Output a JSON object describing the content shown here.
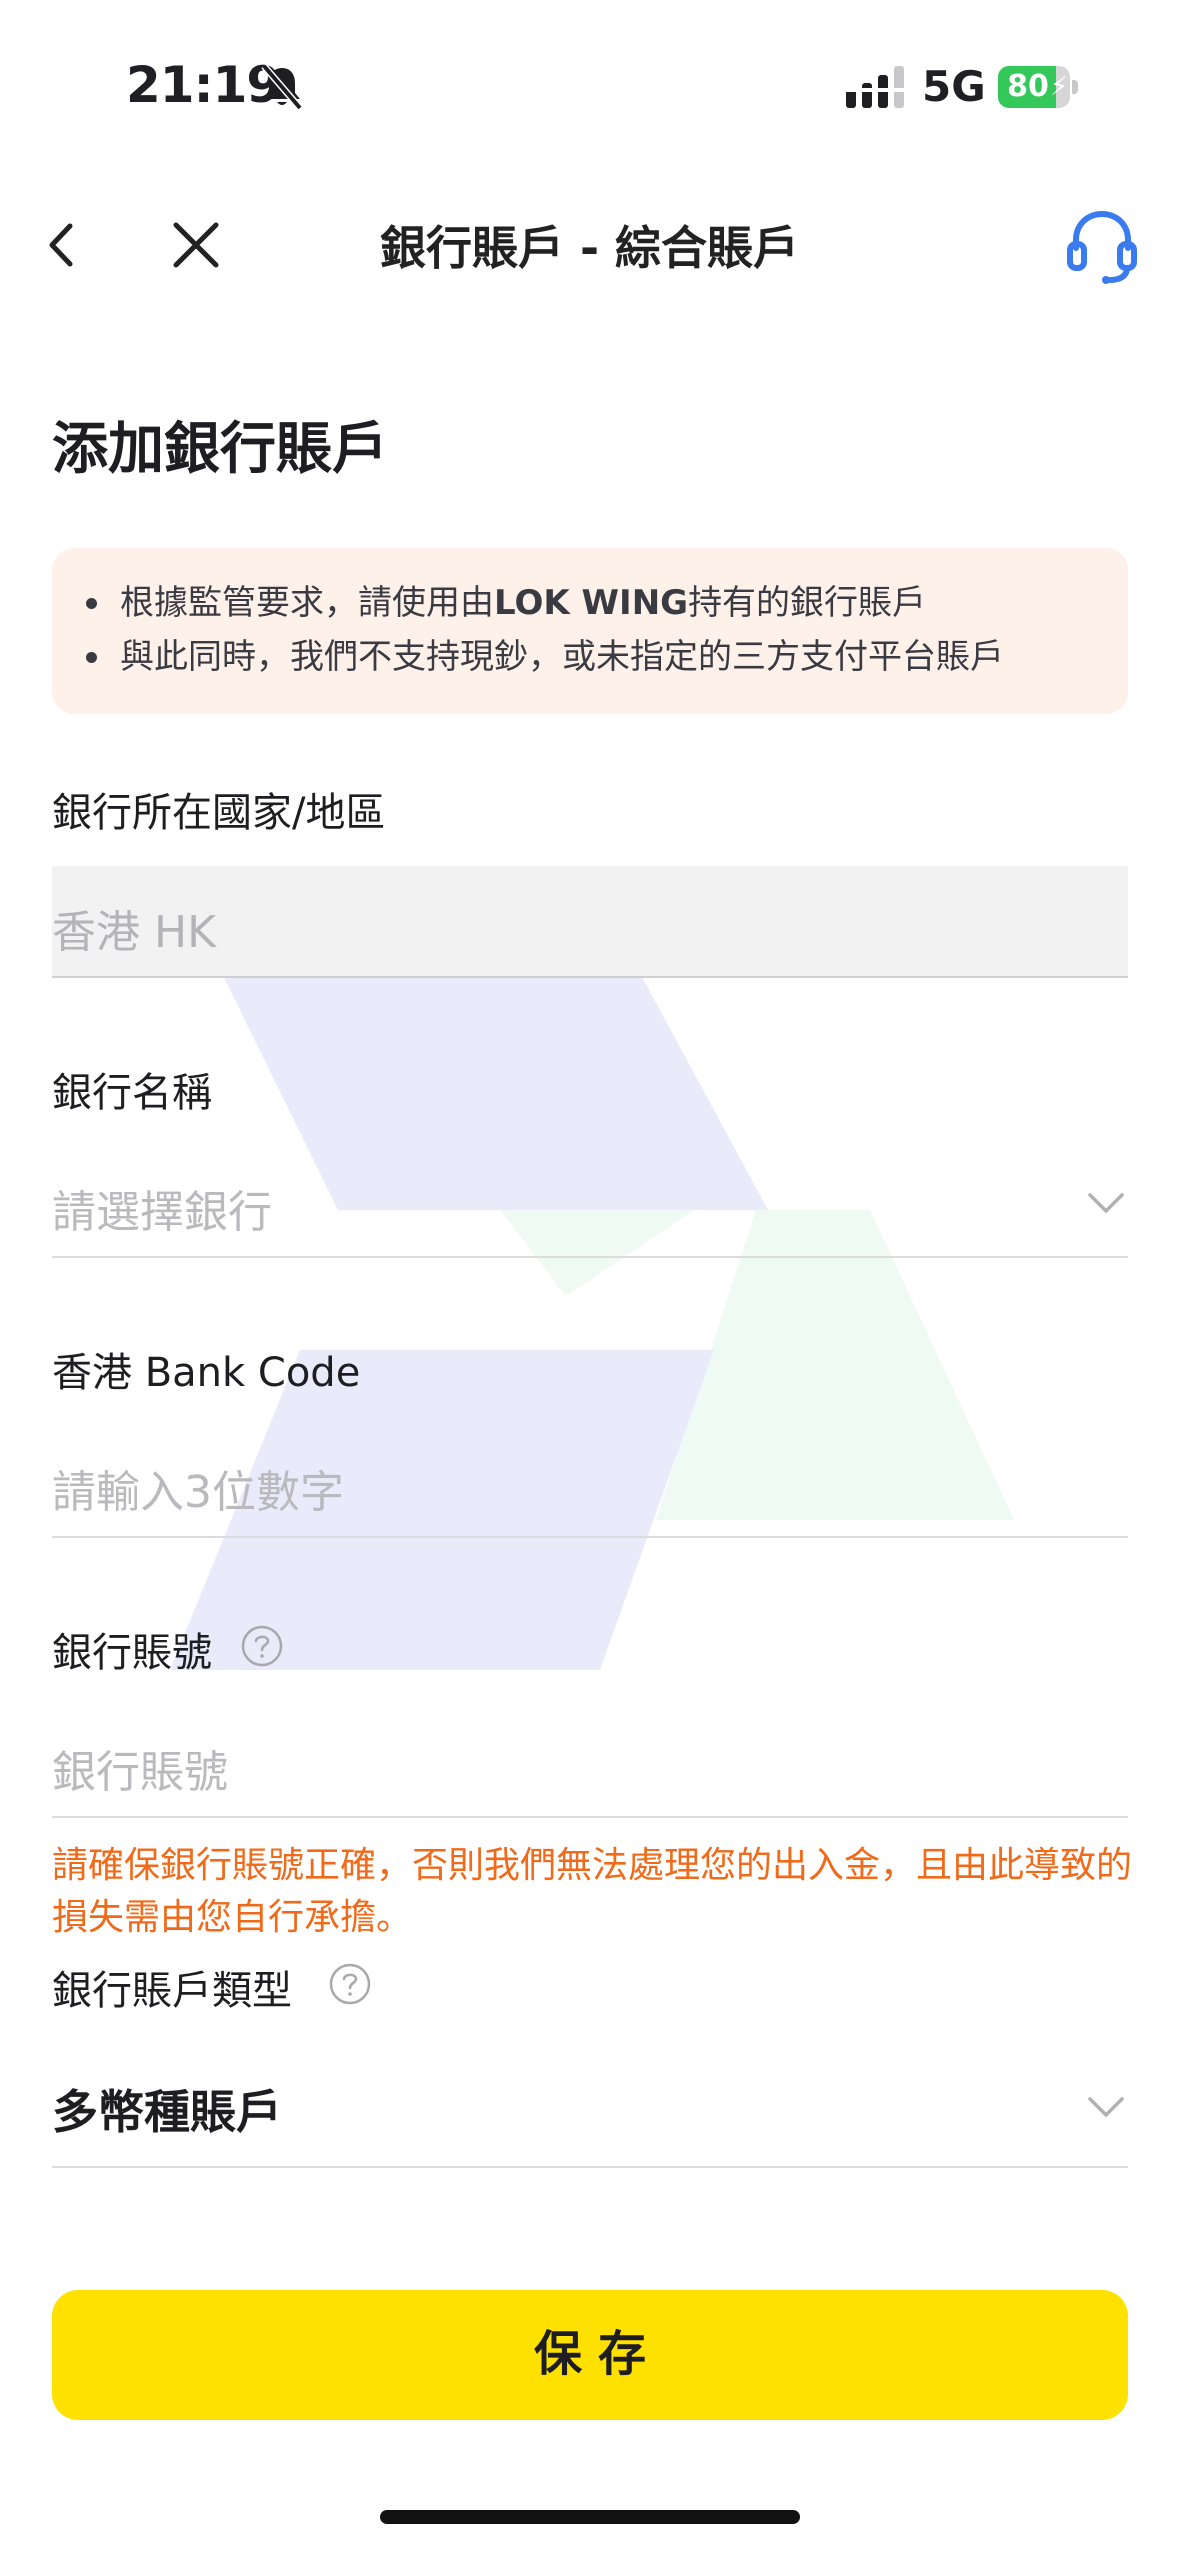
{
  "status_bar": {
    "time": "21:19",
    "network": "5G",
    "battery_percent_text": "80",
    "battery_level": 0.8,
    "battery_color": "#34c759"
  },
  "nav": {
    "title": "銀行賬戶 - 綜合賬戶",
    "back_icon": "chevron-left-icon",
    "close_icon": "close-icon",
    "support_icon": "headset-icon",
    "accent_color": "#3a7bf0"
  },
  "page_title": "添加銀行賬戶",
  "notice": {
    "background": "#fdf1e9",
    "items": [
      {
        "prefix": "根據監管要求，請使用由",
        "highlight": "LOK WING",
        "suffix": "持有的銀行賬戶"
      },
      {
        "prefix": "與此同時，我們不支持現鈔，或未指定的三方支付平台賬戶",
        "highlight": "",
        "suffix": ""
      }
    ]
  },
  "form": {
    "country": {
      "label": "銀行所在國家/地區",
      "value": "香港 HK"
    },
    "bank_name": {
      "label": "銀行名稱",
      "placeholder": "請選擇銀行"
    },
    "bank_code": {
      "label": "香港 Bank Code",
      "placeholder": "請輸入3位數字"
    },
    "account_number": {
      "label": "銀行賬號",
      "placeholder": "銀行賬號",
      "warning": "請確保銀行賬號正確，否則我們無法處理您的出入金，且由此導致的損失需由您自行承擔。"
    },
    "account_type": {
      "label": "銀行賬戶類型",
      "value": "多幣種賬戶"
    }
  },
  "save_button": {
    "label": "保存",
    "color": "#ffe100"
  },
  "warning_color": "#f06a1a"
}
